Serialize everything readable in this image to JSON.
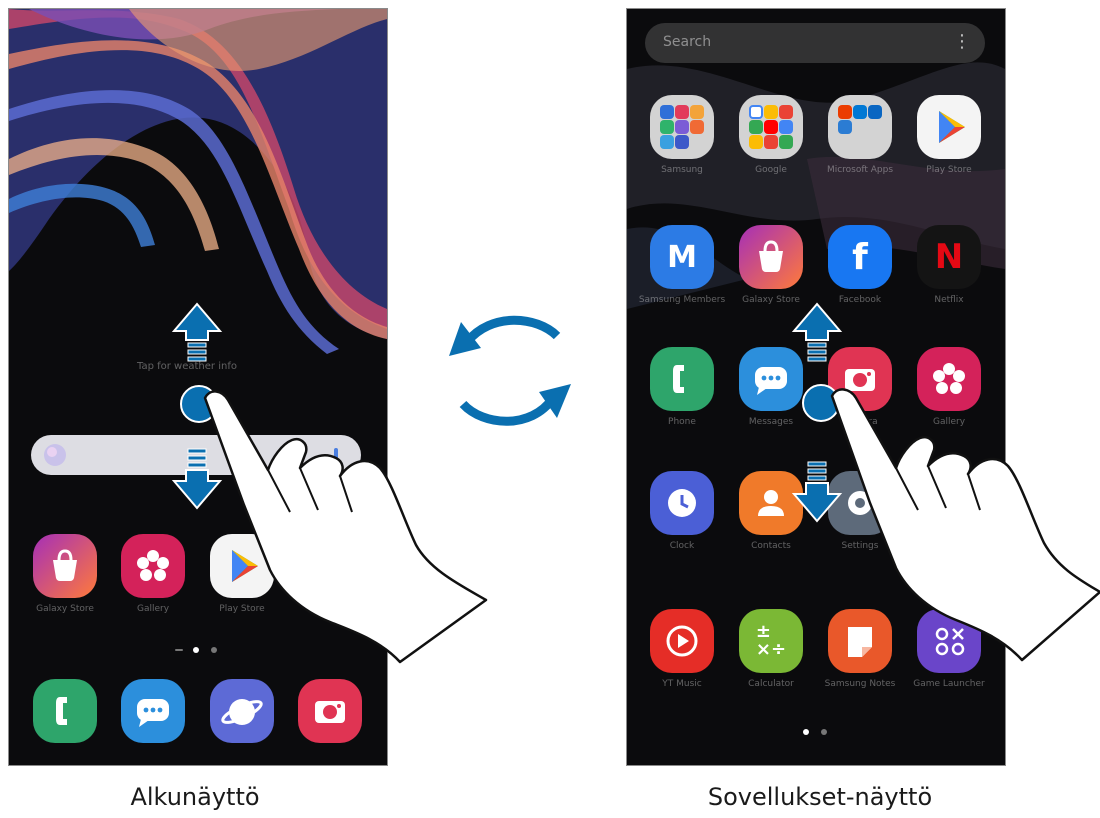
{
  "captions": {
    "home": "Alkunäyttö",
    "apps": "Sovellukset-näyttö"
  },
  "colors": {
    "arrow": "#0a6fb0",
    "cycle_arrow": "#0a6fb0",
    "screen_bg": "#0b0b0d"
  },
  "home_screen": {
    "swipe_hint": "Tap for weather info",
    "search_bar": {
      "placeholder": ""
    },
    "apps": [
      {
        "label": "Galaxy Store",
        "icon": "galaxy-store-icon",
        "color": "#c2279d"
      },
      {
        "label": "Gallery",
        "icon": "gallery-icon",
        "color": "#d4225a"
      },
      {
        "label": "Play Store",
        "icon": "play-store-icon",
        "color": "#f4f4f4"
      },
      {
        "label": "",
        "icon": "",
        "color": ""
      }
    ],
    "page_indicator": {
      "count": 3,
      "active": 1
    },
    "dock": [
      {
        "label": "Phone",
        "icon": "phone-icon",
        "color": "#2ea56b"
      },
      {
        "label": "Messages",
        "icon": "messages-icon",
        "color": "#2c8fdc"
      },
      {
        "label": "Internet",
        "icon": "internet-icon",
        "color": "#5d6ad6"
      },
      {
        "label": "Camera",
        "icon": "camera-icon",
        "color": "#e03453"
      }
    ]
  },
  "apps_screen": {
    "search_placeholder": "Search",
    "more_icon": "more-vertical-icon",
    "rows": [
      [
        {
          "label": "Samsung",
          "icon": "folder-icon"
        },
        {
          "label": "Google",
          "icon": "folder-icon"
        },
        {
          "label": "Microsoft Apps",
          "icon": "folder-icon"
        },
        {
          "label": "Play Store",
          "icon": "play-store-icon"
        }
      ],
      [
        {
          "label": "Samsung Members",
          "icon": "samsung-members-icon"
        },
        {
          "label": "Galaxy Store",
          "icon": "galaxy-store-icon"
        },
        {
          "label": "Facebook",
          "icon": "facebook-icon"
        },
        {
          "label": "Netflix",
          "icon": "netflix-icon"
        }
      ],
      [
        {
          "label": "Phone",
          "icon": "phone-icon"
        },
        {
          "label": "Messages",
          "icon": "messages-icon"
        },
        {
          "label": "Camera",
          "icon": "camera-icon"
        },
        {
          "label": "Gallery",
          "icon": "gallery-icon"
        }
      ],
      [
        {
          "label": "Clock",
          "icon": "clock-icon"
        },
        {
          "label": "Contacts",
          "icon": "contacts-icon"
        },
        {
          "label": "Settings",
          "icon": "settings-icon"
        },
        {
          "label": "",
          "icon": ""
        }
      ],
      [
        {
          "label": "YT Music",
          "icon": "yt-music-icon"
        },
        {
          "label": "Calculator",
          "icon": "calculator-icon"
        },
        {
          "label": "Samsung Notes",
          "icon": "samsung-notes-icon"
        },
        {
          "label": "Game Launcher",
          "icon": "game-launcher-icon"
        }
      ]
    ],
    "page_indicator": {
      "count": 2,
      "active": 0
    }
  }
}
